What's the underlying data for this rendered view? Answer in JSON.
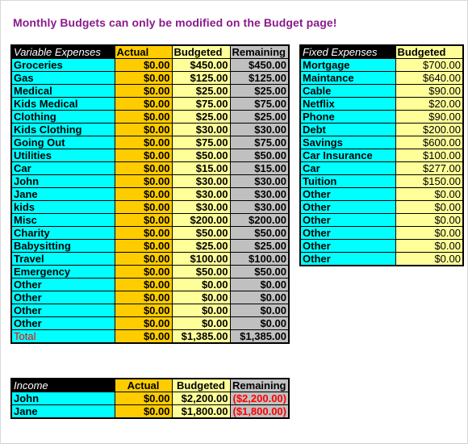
{
  "notice": "Monthly Budgets can only be modified on the Budget page!",
  "variable_expenses": {
    "headers": [
      "Variable Expenses",
      "Actual",
      "Budgeted",
      "Remaining"
    ],
    "rows": [
      {
        "name": "Groceries",
        "actual": "$0.00",
        "budgeted": "$450.00",
        "remaining": "$450.00"
      },
      {
        "name": "Gas",
        "actual": "$0.00",
        "budgeted": "$125.00",
        "remaining": "$125.00"
      },
      {
        "name": "Medical",
        "actual": "$0.00",
        "budgeted": "$25.00",
        "remaining": "$25.00"
      },
      {
        "name": "Kids Medical",
        "actual": "$0.00",
        "budgeted": "$75.00",
        "remaining": "$75.00"
      },
      {
        "name": "Clothing",
        "actual": "$0.00",
        "budgeted": "$25.00",
        "remaining": "$25.00"
      },
      {
        "name": "Kids Clothing",
        "actual": "$0.00",
        "budgeted": "$30.00",
        "remaining": "$30.00"
      },
      {
        "name": "Going Out",
        "actual": "$0.00",
        "budgeted": "$75.00",
        "remaining": "$75.00"
      },
      {
        "name": "Utilities",
        "actual": "$0.00",
        "budgeted": "$50.00",
        "remaining": "$50.00"
      },
      {
        "name": "Car",
        "actual": "$0.00",
        "budgeted": "$15.00",
        "remaining": "$15.00"
      },
      {
        "name": "John",
        "actual": "$0.00",
        "budgeted": "$30.00",
        "remaining": "$30.00"
      },
      {
        "name": "Jane",
        "actual": "$0.00",
        "budgeted": "$30.00",
        "remaining": "$30.00"
      },
      {
        "name": "kids",
        "actual": "$0.00",
        "budgeted": "$30.00",
        "remaining": "$30.00"
      },
      {
        "name": "Misc",
        "actual": "$0.00",
        "budgeted": "$200.00",
        "remaining": "$200.00"
      },
      {
        "name": "Charity",
        "actual": "$0.00",
        "budgeted": "$50.00",
        "remaining": "$50.00"
      },
      {
        "name": "Babysitting",
        "actual": "$0.00",
        "budgeted": "$25.00",
        "remaining": "$25.00"
      },
      {
        "name": "Travel",
        "actual": "$0.00",
        "budgeted": "$100.00",
        "remaining": "$100.00"
      },
      {
        "name": "Emergency",
        "actual": "$0.00",
        "budgeted": "$50.00",
        "remaining": "$50.00"
      },
      {
        "name": "Other",
        "actual": "$0.00",
        "budgeted": "$0.00",
        "remaining": "$0.00"
      },
      {
        "name": "Other",
        "actual": "$0.00",
        "budgeted": "$0.00",
        "remaining": "$0.00"
      },
      {
        "name": "Other",
        "actual": "$0.00",
        "budgeted": "$0.00",
        "remaining": "$0.00"
      },
      {
        "name": "Other",
        "actual": "$0.00",
        "budgeted": "$0.00",
        "remaining": "$0.00"
      }
    ],
    "total": {
      "name": "Total",
      "actual": "$0.00",
      "budgeted": "$1,385.00",
      "remaining": "$1,385.00"
    }
  },
  "fixed_expenses": {
    "headers": [
      "Fixed Expenses",
      "Budgeted"
    ],
    "rows": [
      {
        "name": "Mortgage",
        "budgeted": "$700.00"
      },
      {
        "name": "Maintance",
        "budgeted": "$640.00"
      },
      {
        "name": "Cable",
        "budgeted": "$90.00"
      },
      {
        "name": "Netflix",
        "budgeted": "$20.00"
      },
      {
        "name": "Phone",
        "budgeted": "$90.00"
      },
      {
        "name": "Debt",
        "budgeted": "$200.00"
      },
      {
        "name": "Savings",
        "budgeted": "$600.00"
      },
      {
        "name": "Car Insurance",
        "budgeted": "$100.00"
      },
      {
        "name": "Car",
        "budgeted": "$277.00"
      },
      {
        "name": "Tuition",
        "budgeted": "$150.00"
      },
      {
        "name": "Other",
        "budgeted": "$0.00"
      },
      {
        "name": "Other",
        "budgeted": "$0.00"
      },
      {
        "name": "Other",
        "budgeted": "$0.00"
      },
      {
        "name": "Other",
        "budgeted": "$0.00"
      },
      {
        "name": "Other",
        "budgeted": "$0.00"
      },
      {
        "name": "Other",
        "budgeted": "$0.00"
      }
    ]
  },
  "income": {
    "headers": [
      "Income",
      "Actual",
      "Budgeted",
      "Remaining"
    ],
    "rows": [
      {
        "name": "John",
        "actual": "$0.00",
        "budgeted": "$2,200.00",
        "remaining": "($2,200.00)"
      },
      {
        "name": "Jane",
        "actual": "$0.00",
        "budgeted": "$1,800.00",
        "remaining": "($1,800.00)"
      }
    ]
  },
  "colors": {
    "notice": "#8b1a8b",
    "name_cell": "#00ffff",
    "actual_cell": "#ffcc00",
    "budgeted_cell": "#ffff99",
    "remaining_cell": "#c0c0c0",
    "header_black": "#000000",
    "negative": "#ff0000"
  }
}
